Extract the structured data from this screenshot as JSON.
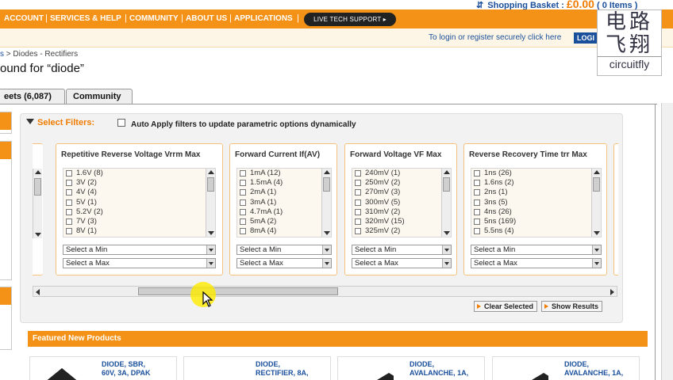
{
  "header": {
    "basket_label": "Shopping Basket :",
    "basket_amount": "£0.00",
    "basket_items": "( 0 Items )"
  },
  "nav": {
    "items": [
      "ACCOUNT",
      "SERVICES & HELP",
      "COMMUNITY",
      "ABOUT US",
      "APPLICATIONS"
    ],
    "live_support": "LIVE TECH SUPPORT ▸"
  },
  "login": {
    "text": "To login or register securely click here",
    "button": "LOGI"
  },
  "logo": {
    "line1": "电路",
    "line2": "飞翔",
    "english": "circuitfly"
  },
  "breadcrumb": {
    "prefix": "s",
    "separator": " > ",
    "current": "Diodes - Rectifiers"
  },
  "page_title": "ound for “diode”",
  "tabs": [
    {
      "label": "eets (6,087)"
    },
    {
      "label": "Community"
    }
  ],
  "filters": {
    "select_filters_label": "Select Filters:",
    "auto_apply_label": "Auto Apply filters to update parametric options dynamically",
    "select_min": "Select a Min",
    "select_max": "Select a Max",
    "columns": [
      {
        "title": "Repetitive Reverse Voltage Vrrm Max",
        "options": [
          "1.6V (8)",
          "3V (2)",
          "4V (4)",
          "5V (1)",
          "5.2V (2)",
          "7V (3)",
          "8V (1)"
        ]
      },
      {
        "title": "Forward Current If(AV)",
        "options": [
          "1mA (12)",
          "1.5mA (4)",
          "2mA (1)",
          "3mA (1)",
          "4.7mA (1)",
          "5mA (2)",
          "8mA (4)"
        ]
      },
      {
        "title": "Forward Voltage VF Max",
        "options": [
          "240mV (1)",
          "250mV (2)",
          "270mV (3)",
          "300mV (5)",
          "310mV (2)",
          "320mV (15)",
          "325mV (2)"
        ]
      },
      {
        "title": "Reverse Recovery Time trr Max",
        "options": [
          "1ns (26)",
          "1.6ns (2)",
          "2ns (1)",
          "3ns (5)",
          "4ns (26)",
          "5ns (169)",
          "5.5ns (4)"
        ]
      }
    ],
    "clear_selected": "Clear Selected",
    "show_results": "Show Results"
  },
  "featured": {
    "title": "Featured New Products",
    "products": [
      {
        "line1": "DIODE, SBR,",
        "line2": "60V, 3A, DPAK"
      },
      {
        "line1": "DIODE,",
        "line2": "RECTIFIER, 8A,"
      },
      {
        "line1": "DIODE,",
        "line2": "AVALANCHE, 1A,"
      },
      {
        "line1": "DIODE,",
        "line2": "AVALANCHE, 1A,"
      }
    ]
  },
  "colors": {
    "brand_orange": "#f39217",
    "link_blue": "#1a4f9c",
    "cursor_highlight": "#ffeb00"
  }
}
